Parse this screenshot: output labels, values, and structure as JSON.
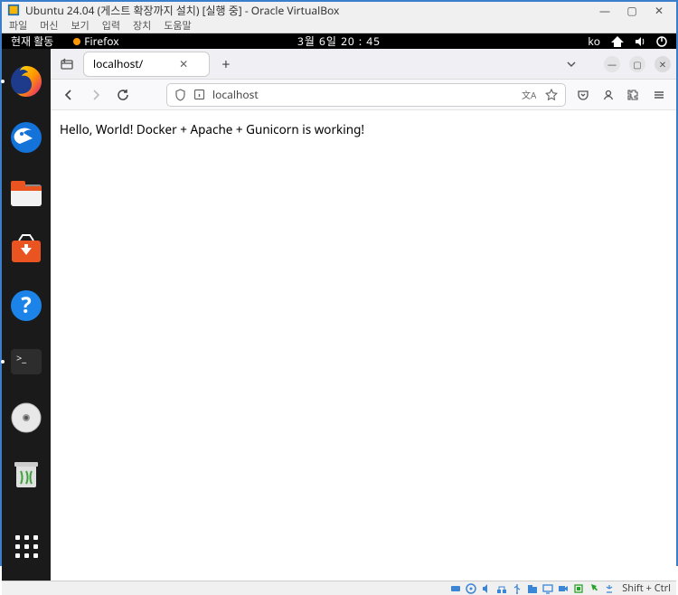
{
  "virtualbox": {
    "title": "Ubuntu 24.04 (게스트 확장까지 설치) [실행 중] - Oracle VirtualBox",
    "menu": {
      "file": "파일",
      "machine": "머신",
      "view": "보기",
      "input": "입력",
      "devices": "장치",
      "help": "도움말"
    },
    "status": {
      "hostkey": "Shift + Ctrl"
    }
  },
  "ubuntu": {
    "activities": "현재 활동",
    "appname": "Firefox",
    "clock": "3월 6일  20 : 45",
    "input_indicator": "ko"
  },
  "firefox": {
    "tab": {
      "title": "localhost/"
    },
    "newtab": "+",
    "urlbar": {
      "url": "localhost"
    }
  },
  "page": {
    "body": "Hello, World! Docker + Apache + Gunicorn is working!"
  }
}
